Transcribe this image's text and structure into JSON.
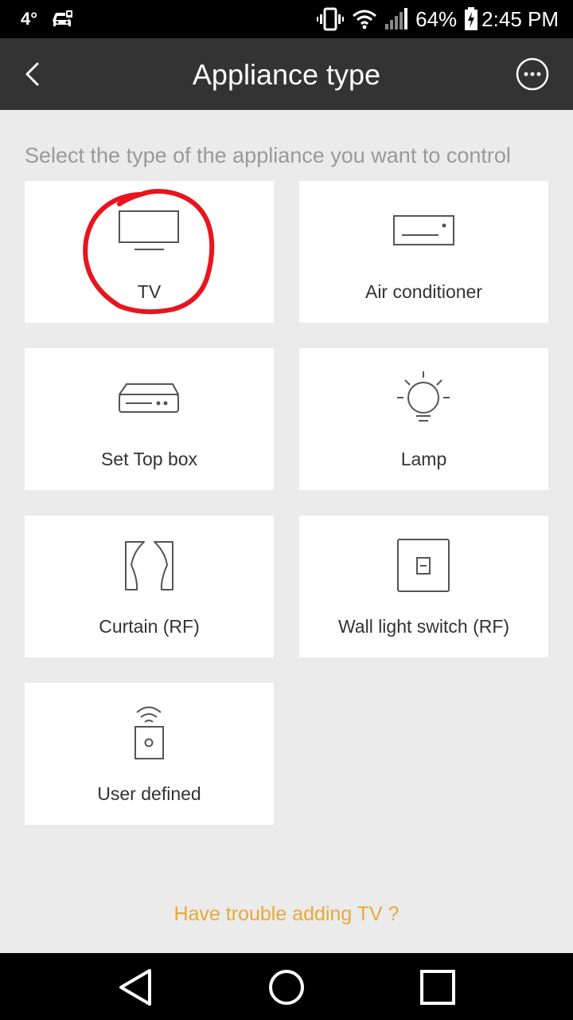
{
  "status_bar": {
    "temperature": "4°",
    "battery_percent": "64%",
    "time": "2:45 PM"
  },
  "header": {
    "title": "Appliance type"
  },
  "subtitle": "Select the type of the appliance you want to control",
  "tiles": [
    {
      "label": "TV",
      "icon": "tv-icon"
    },
    {
      "label": "Air conditioner",
      "icon": "air-conditioner-icon"
    },
    {
      "label": "Set Top box",
      "icon": "set-top-box-icon"
    },
    {
      "label": "Lamp",
      "icon": "lamp-icon"
    },
    {
      "label": "Curtain (RF)",
      "icon": "curtain-icon"
    },
    {
      "label": "Wall light switch (RF)",
      "icon": "wall-switch-icon"
    },
    {
      "label": "User defined",
      "icon": "remote-icon"
    }
  ],
  "trouble_link": "Have trouble adding TV ?",
  "colors": {
    "background": "#ebebeb",
    "app_bar": "#333333",
    "link": "#e8a93a",
    "annotation": "#e8141e"
  }
}
